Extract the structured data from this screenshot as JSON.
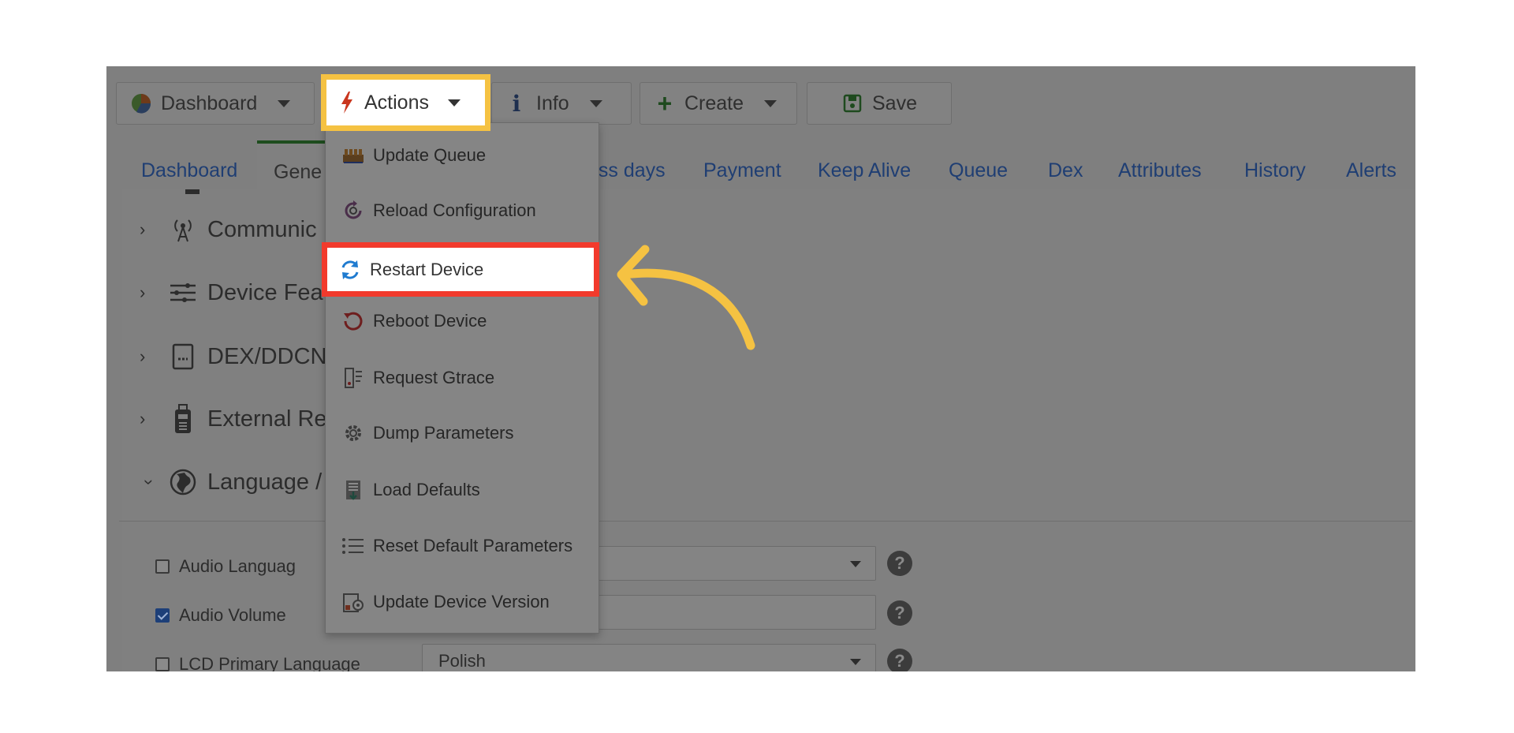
{
  "toolbar": {
    "dashboard_label": "Dashboard",
    "actions_label": "Actions",
    "info_label": "Info",
    "create_label": "Create",
    "save_label": "Save"
  },
  "tabs": {
    "dashboard": "Dashboard",
    "general": "Gene",
    "business_days": "ess days",
    "payment": "Payment",
    "keep_alive": "Keep Alive",
    "queue": "Queue",
    "dex": "Dex",
    "attributes": "Attributes",
    "history": "History",
    "alerts": "Alerts"
  },
  "sections": [
    {
      "label": "Communic",
      "expanded": false
    },
    {
      "label": "Device Fea",
      "expanded": false
    },
    {
      "label": "DEX/DDCN",
      "expanded": false
    },
    {
      "label": "External Re",
      "expanded": false
    },
    {
      "label": "Language /",
      "expanded": true
    }
  ],
  "settings": [
    {
      "label": "Audio Languag",
      "checked": false,
      "value": ""
    },
    {
      "label": "Audio Volume",
      "checked": true,
      "value": ""
    },
    {
      "label": "LCD Primary Language",
      "checked": false,
      "value": "Polish"
    }
  ],
  "help_glyph": "?",
  "actions_menu": {
    "items": [
      {
        "label": "Update Queue",
        "icon": "queue-icon"
      },
      {
        "label": "Reload Configuration",
        "icon": "reload-config-icon"
      },
      {
        "label": "Restart Device",
        "icon": "restart-icon"
      },
      {
        "label": "Reboot Device",
        "icon": "reboot-icon"
      },
      {
        "label": "Request Gtrace",
        "icon": "gtrace-icon"
      },
      {
        "label": "Dump Parameters",
        "icon": "gear-icon"
      },
      {
        "label": "Load Defaults",
        "icon": "load-defaults-icon"
      },
      {
        "label": "Reset Default Parameters",
        "icon": "list-icon"
      },
      {
        "label": "Update Device Version",
        "icon": "device-version-icon"
      }
    ]
  },
  "colors": {
    "actions_highlight": "#f5c242",
    "restart_highlight": "#f23a2c",
    "arrow": "#f5c242",
    "overlay": "#7f7f7f"
  }
}
